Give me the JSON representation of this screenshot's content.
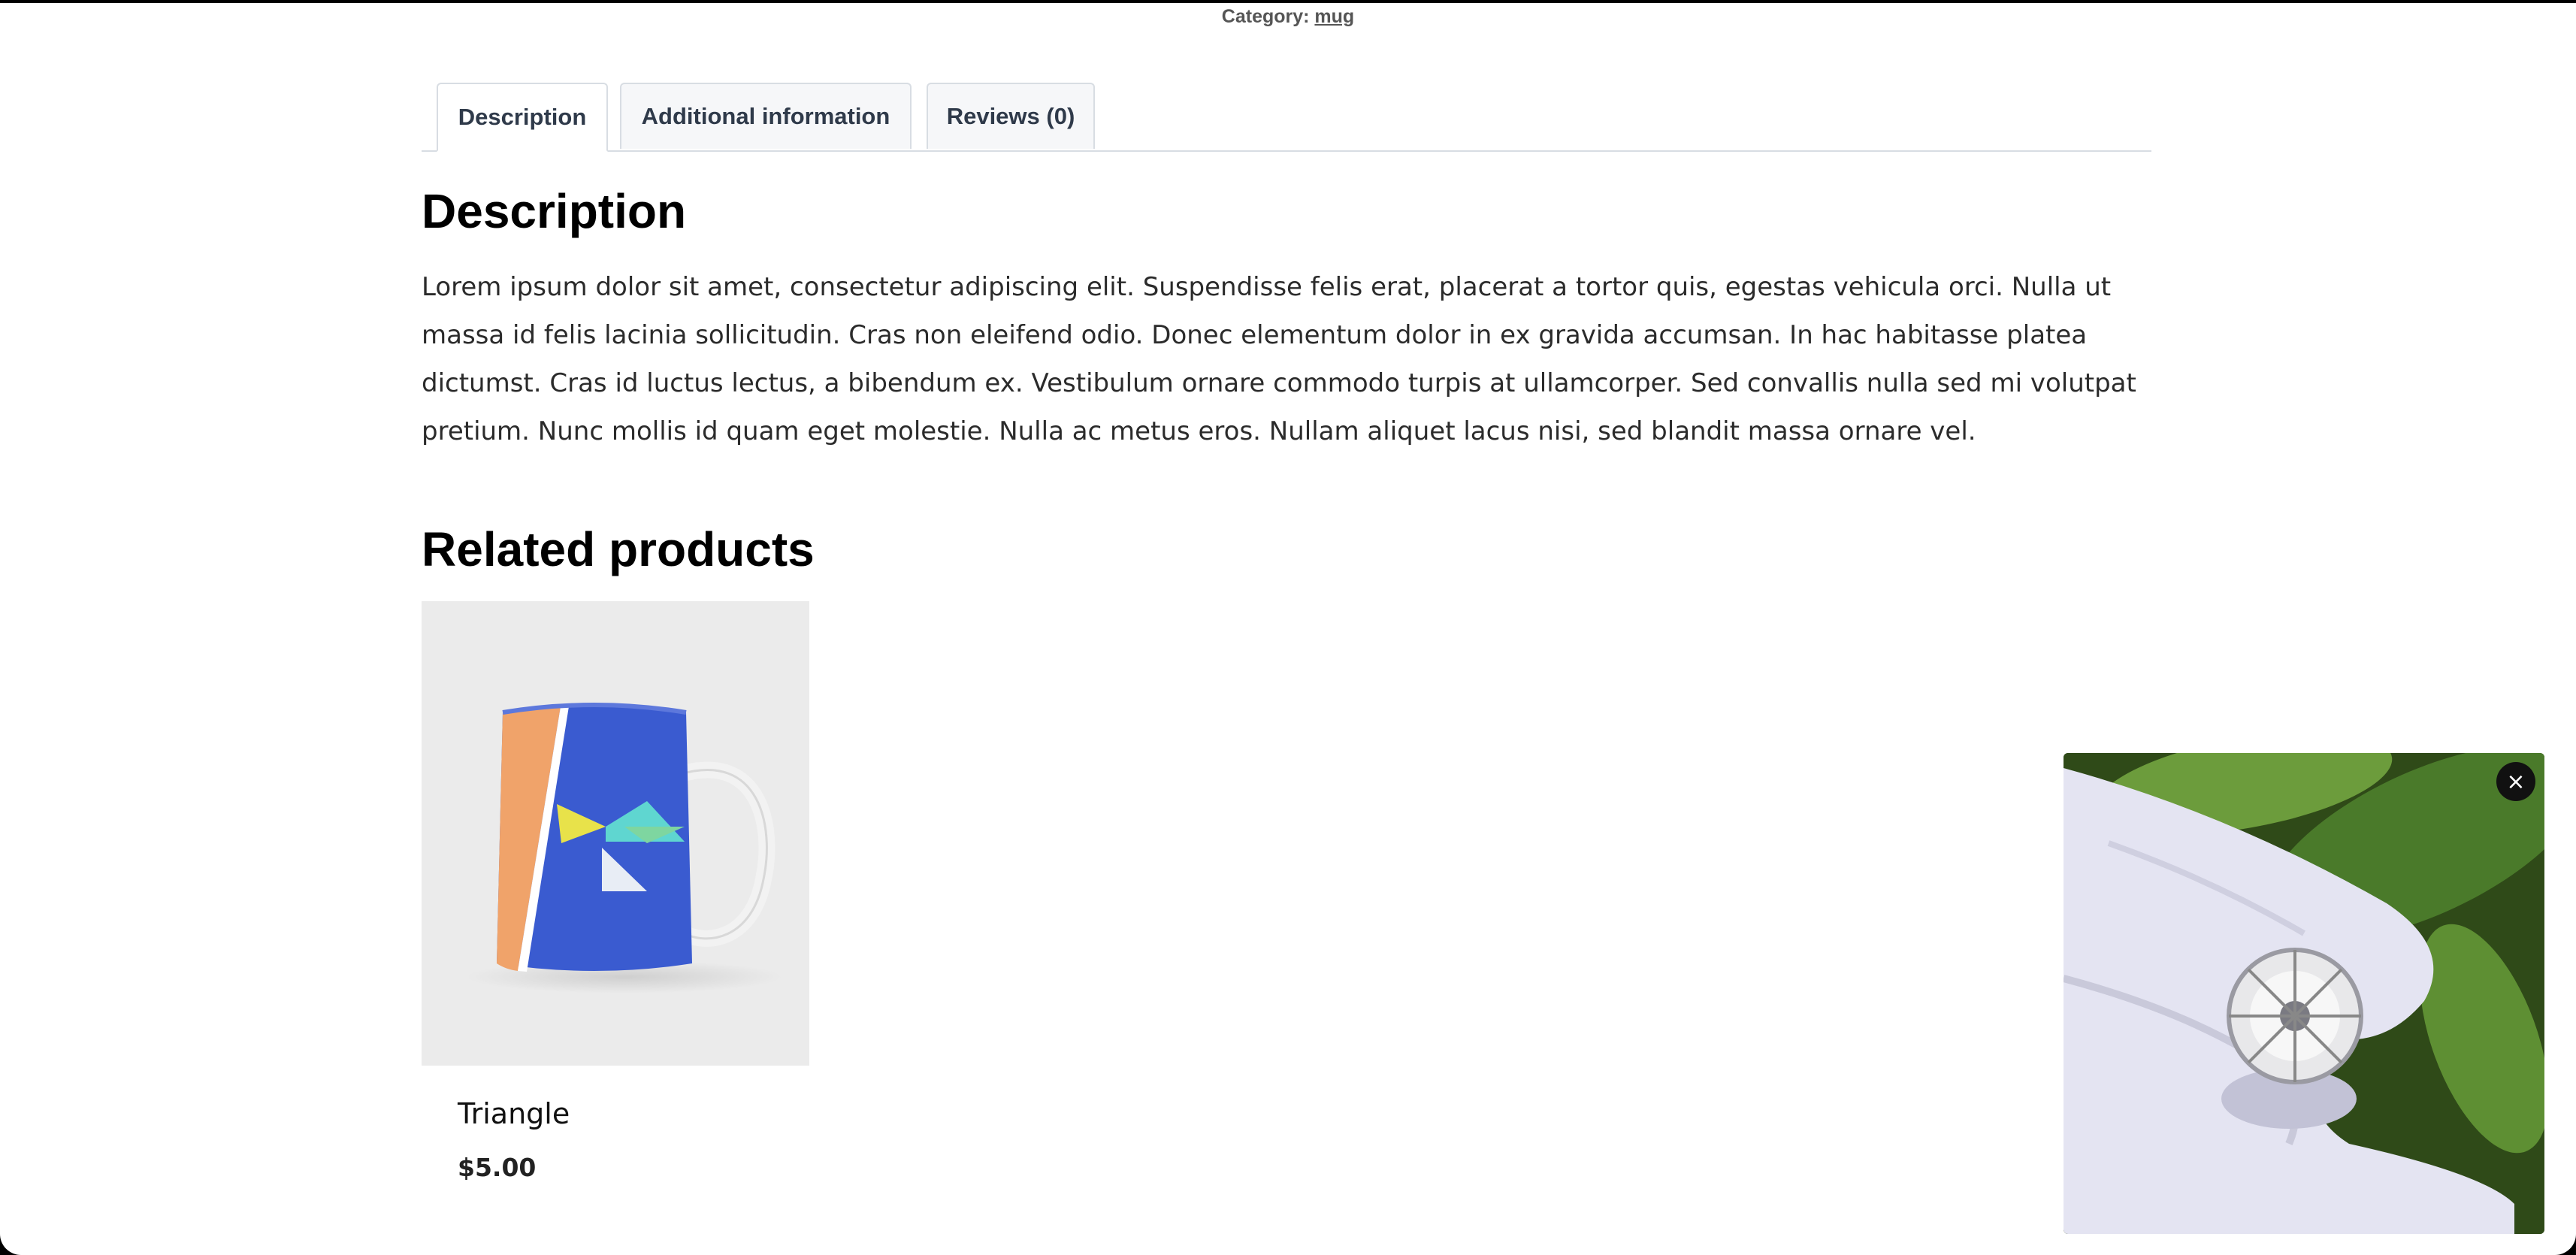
{
  "breadcrumb": {
    "category_label": "Category:",
    "category_link": "mug"
  },
  "tabs": [
    {
      "label": "Description",
      "active": true
    },
    {
      "label": "Additional information",
      "active": false
    },
    {
      "label": "Reviews (0)",
      "active": false
    }
  ],
  "description": {
    "heading": "Description",
    "body": "Lorem ipsum dolor sit amet, consectetur adipiscing elit. Suspendisse felis erat, placerat a tortor quis, egestas vehicula orci. Nulla ut massa id felis lacinia sollicitudin. Cras non eleifend odio. Donec elementum dolor in ex gravida accumsan. In hac habitasse platea dictumst. Cras id luctus lectus, a bibendum ex. Vestibulum ornare commodo turpis at ullamcorper. Sed convallis nulla sed mi volutpat pretium. Nunc mollis id quam eget molestie. Nulla ac metus eros. Nullam aliquet lacus nisi, sed blandit massa ornare vel."
  },
  "related": {
    "heading": "Related products",
    "products": [
      {
        "name": "Triangle",
        "price": "$5.00"
      }
    ]
  },
  "video_popup": {
    "close_symbol": "×"
  },
  "colors": {
    "mug_blue": "#3a5bd0",
    "mug_orange": "#f0a36a",
    "mug_yellow": "#e8e24a",
    "mug_cyan": "#5fd6d0",
    "tab_border": "#d8dde3"
  }
}
